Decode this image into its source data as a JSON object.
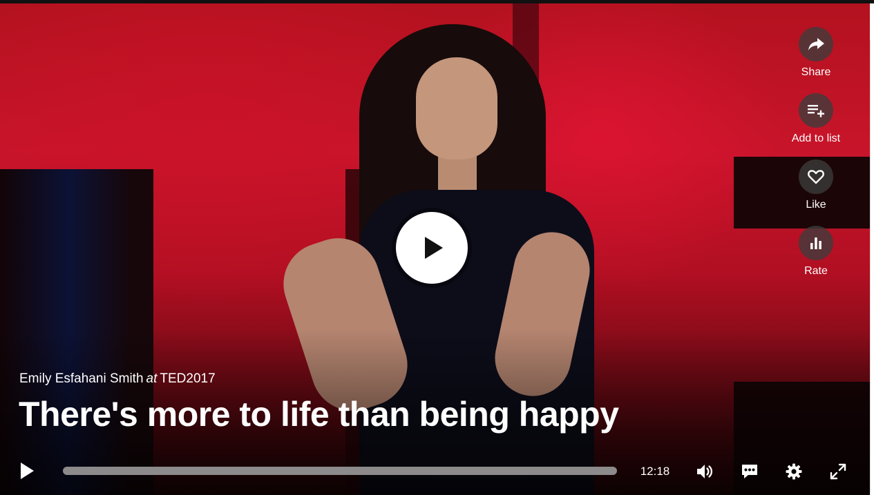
{
  "video": {
    "speaker": "Emily Esfahani Smith",
    "at_word": "at",
    "event": "TED2017",
    "title": "There's more to life than being happy"
  },
  "actions": [
    {
      "label": "Share",
      "icon": "share-icon"
    },
    {
      "label": "Add to list",
      "icon": "playlist-add-icon"
    },
    {
      "label": "Like",
      "icon": "heart-icon"
    },
    {
      "label": "Rate",
      "icon": "bar-chart-icon"
    }
  ],
  "controls": {
    "duration": "12:18",
    "progress": 0,
    "icons": [
      "play-icon",
      "volume-icon",
      "captions-icon",
      "settings-icon",
      "fullscreen-icon"
    ]
  },
  "colors": {
    "accent_red": "#c8142a",
    "overlay_button": "#3c3c3c",
    "progress_track": "#8c8a8a"
  }
}
